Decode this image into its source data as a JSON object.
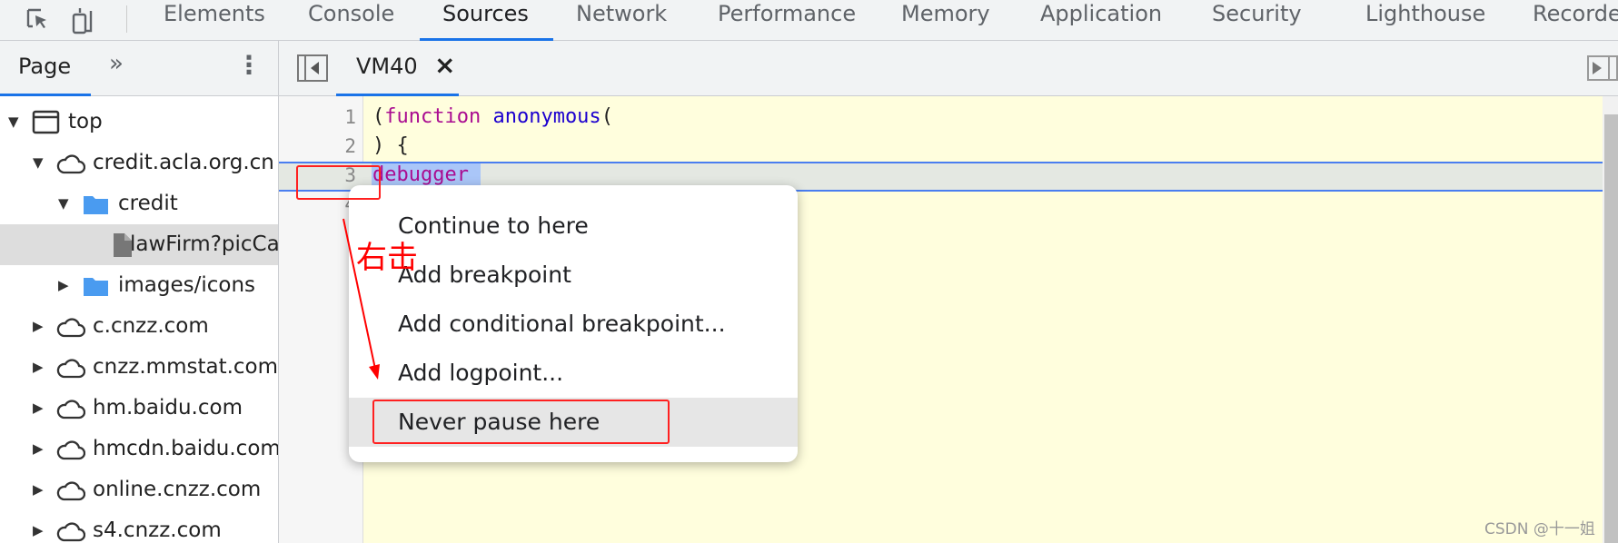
{
  "toolbar": {
    "icons": [
      "inspect-element-icon",
      "device-toggle-icon"
    ],
    "tabs": [
      "Elements",
      "Console",
      "Sources",
      "Network",
      "Performance",
      "Memory",
      "Application",
      "Security",
      "Lighthouse",
      "Recorder"
    ],
    "active": "Sources"
  },
  "navigator": {
    "tab": "Page",
    "more": "»",
    "menu": "⋮",
    "tree": [
      {
        "label": "top",
        "icon": "frame-icon",
        "expanded": true
      },
      {
        "label": "credit.acla.org.cn",
        "icon": "cloud-icon",
        "expanded": true
      },
      {
        "label": "credit",
        "icon": "folder-icon",
        "expanded": true
      },
      {
        "label": "lawFirm?picCaptchaVerification=",
        "icon": "file-icon",
        "selected": true
      },
      {
        "label": "images/icons",
        "icon": "folder-icon",
        "expanded": false
      },
      {
        "label": "c.cnzz.com",
        "icon": "cloud-icon",
        "expanded": false
      },
      {
        "label": "cnzz.mmstat.com",
        "icon": "cloud-icon",
        "expanded": false
      },
      {
        "label": "hm.baidu.com",
        "icon": "cloud-icon",
        "expanded": false
      },
      {
        "label": "hmcdn.baidu.com",
        "icon": "cloud-icon",
        "expanded": false
      },
      {
        "label": "online.cnzz.com",
        "icon": "cloud-icon",
        "expanded": false
      },
      {
        "label": "s4.cnzz.com",
        "icon": "cloud-icon",
        "expanded": false
      }
    ]
  },
  "editor": {
    "file_tab": "VM40",
    "close": "×",
    "lines": [
      {
        "n": "1",
        "parts": [
          [
            "(",
            "p"
          ],
          [
            "function",
            "k"
          ],
          [
            " ",
            "p"
          ],
          [
            "anonymous",
            "f"
          ],
          [
            "(",
            "p"
          ]
        ]
      },
      {
        "n": "2",
        "parts": [
          [
            ") {",
            "p"
          ]
        ]
      },
      {
        "n": "3",
        "parts": [
          [
            "debugger",
            "k"
          ]
        ]
      },
      {
        "n": "4",
        "parts": []
      }
    ]
  },
  "context_menu": {
    "items": [
      "Continue to here",
      "Add breakpoint",
      "Add conditional breakpoint...",
      "Add logpoint...",
      "Never pause here"
    ],
    "highlighted": "Never pause here"
  },
  "annotation": {
    "text": "右击",
    "color": "#ff0000"
  },
  "watermark": "CSDN @十一姐",
  "colors": {
    "accent": "#1a73e8",
    "keyword": "#aa0d91",
    "function_name": "#1c00cf",
    "editor_bg": "#fffedd"
  }
}
